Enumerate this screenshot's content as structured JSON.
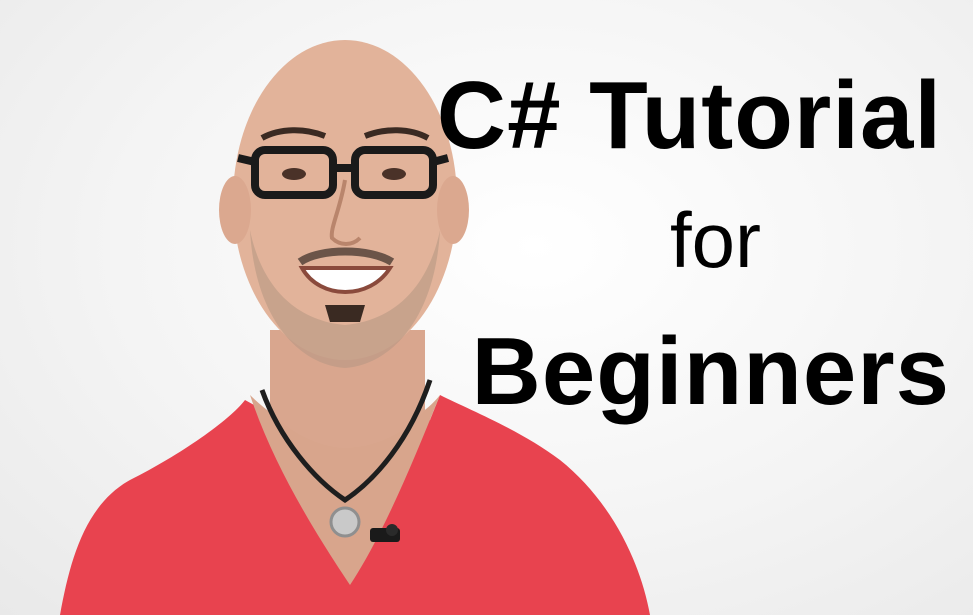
{
  "thumbnail": {
    "title_line1": "C# Tutorial",
    "title_line2": "for",
    "title_line3": "Beginners"
  },
  "colors": {
    "background": "#f3f3f3",
    "shirt": "#e8434f",
    "skin": "#e2b39a",
    "text": "#000000"
  },
  "icons": [
    "presenter-photo",
    "pendant",
    "lapel-microphone"
  ]
}
